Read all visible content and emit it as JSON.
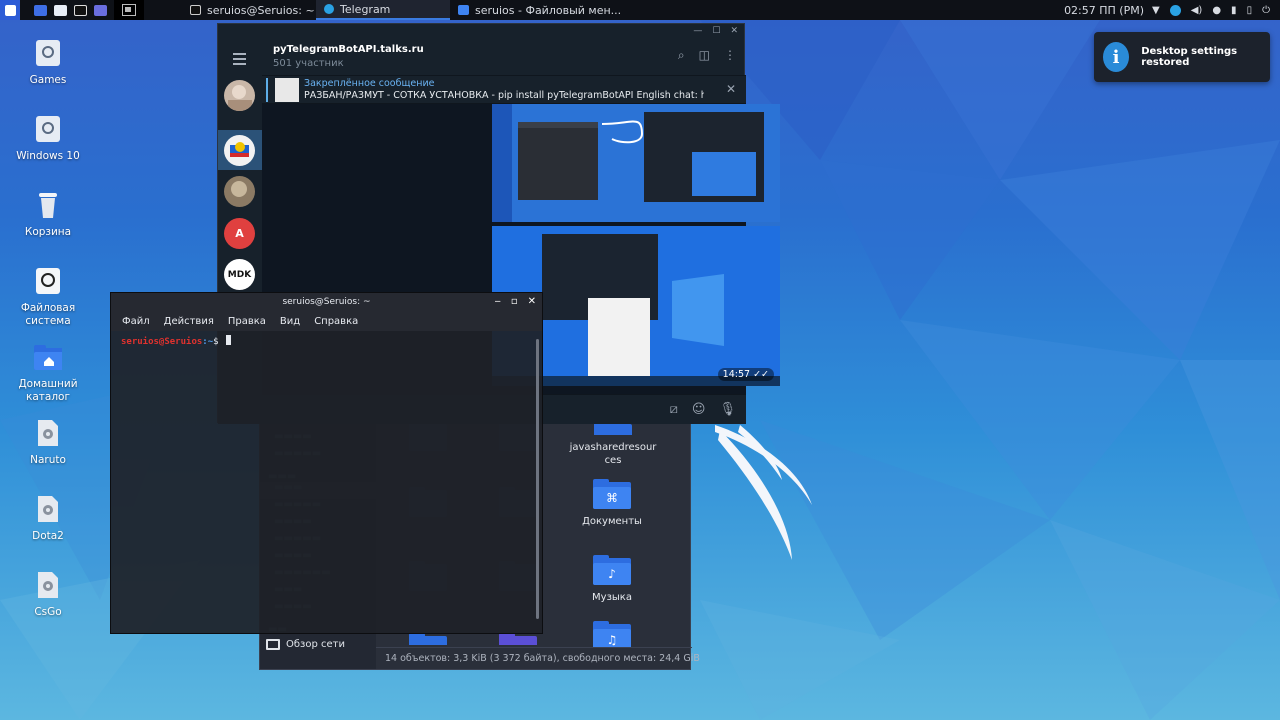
{
  "panel": {
    "tasks": [
      {
        "label": "seruios@Seruios: ~"
      },
      {
        "label": "Telegram"
      },
      {
        "label": "seruios - Файловый мен..."
      }
    ],
    "clock": "02:57 ПП (PM)"
  },
  "desktop": {
    "icons": [
      {
        "label": "Games"
      },
      {
        "label": "Windows 10"
      },
      {
        "label": "Корзина"
      },
      {
        "label": "Файловая система"
      },
      {
        "label": "Домашний каталог"
      },
      {
        "label": "Naruto"
      },
      {
        "label": "Dota2"
      },
      {
        "label": "CsGo"
      }
    ]
  },
  "notification": {
    "icon": "i",
    "text": "Desktop settings restored"
  },
  "telegram": {
    "chat_title": "pyTelegramBotAPI.talks.ru",
    "members": "501 участник",
    "pinned_title": "Закреплённое сообщение",
    "pinned_text": "РАЗБАН/РАЗМУТ - СОТКА  УСТАНОВКА - pip install pyTelegramBotAPI  English chat: https://telegr...",
    "avatar_letters": [
      "A",
      "MDK"
    ],
    "message_time": "14:57",
    "read_marks": "✓✓"
  },
  "terminal": {
    "title": "seruios@Seruios: ~",
    "menu": [
      "Файл",
      "Действия",
      "Правка",
      "Вид",
      "Справка"
    ],
    "prompt_user": "seruios@Seruios",
    "prompt_path": ":~",
    "prompt_sign": "$"
  },
  "file_manager": {
    "items": [
      {
        "label": "javasharedresources",
        "glyph": ""
      },
      {
        "label": "Документы",
        "glyph": "⌘"
      },
      {
        "label": "Музыка",
        "glyph": "♪"
      }
    ],
    "network_label": "Обзор сети",
    "status": "14 объектов: 3,3 KiB (3 372 байта), свободного места: 24,4 GiB"
  },
  "colors": {
    "accent": "#2a8bd8",
    "panel_bg": "#0e1117",
    "telegram_bg": "#17212b",
    "folder_blue": "#3e84f2",
    "prompt_red": "#e0322e"
  }
}
